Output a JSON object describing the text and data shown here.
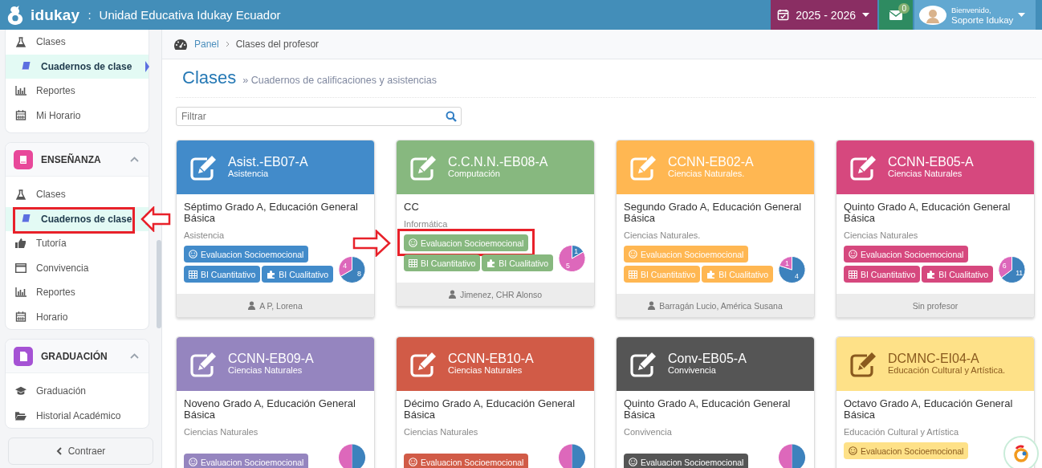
{
  "topbar": {
    "brand": "idukay",
    "separator": ":",
    "school": "Unidad Educativa Idukay Ecuador",
    "year": "2025 - 2026",
    "messages_count": "0",
    "greeting": "Bienvenido,",
    "user": "Soporte Idukay"
  },
  "sidebar": {
    "groups": [
      {
        "items": [
          {
            "kind": "flask",
            "label": "Clases",
            "selected": false,
            "highlighted": false
          },
          {
            "kind": "book",
            "label": "Cuadernos de clase",
            "selected": true,
            "highlighted": false
          },
          {
            "kind": "chart",
            "label": "Reportes",
            "selected": false,
            "highlighted": false
          },
          {
            "kind": "calendar",
            "label": "Mi Horario",
            "selected": false,
            "highlighted": false
          }
        ]
      },
      {
        "title": "ENSEÑANZA",
        "color": "#e8489a",
        "kind": "book",
        "expanded": true,
        "items": [
          {
            "kind": "flask",
            "label": "Clases",
            "selected": false,
            "highlighted": false
          },
          {
            "kind": "book",
            "label": "Cuadernos de clase",
            "selected": true,
            "highlighted": true
          },
          {
            "kind": "thumb",
            "label": "Tutoría",
            "selected": false,
            "highlighted": false
          },
          {
            "kind": "window",
            "label": "Convivencia",
            "selected": false,
            "highlighted": false
          },
          {
            "kind": "chart",
            "label": "Reportes",
            "selected": false,
            "highlighted": false
          },
          {
            "kind": "calendar",
            "label": "Horario",
            "selected": false,
            "highlighted": false
          }
        ]
      },
      {
        "title": "GRADUACIÓN",
        "color": "#a552d4",
        "kind": "doc",
        "expanded": true,
        "items": [
          {
            "kind": "cap",
            "label": "Graduación",
            "selected": false,
            "highlighted": false
          },
          {
            "kind": "folder",
            "label": "Historial Académico",
            "selected": false,
            "highlighted": false
          }
        ]
      }
    ],
    "collapse": "Contraer"
  },
  "breadcrumb": [
    {
      "label": "Panel",
      "link": true
    },
    {
      "label": "Clases del profesor",
      "link": false
    }
  ],
  "page": {
    "title": "Clases",
    "subtitle": "» Cuadernos de calificaciones y asistencias"
  },
  "filter": {
    "placeholder": "Filtrar"
  },
  "cards": [
    {
      "code": "Asist.-EB07-A",
      "subject": "Asistencia",
      "color": "#428bca",
      "grade": "Séptimo Grado A, Educación General Básica",
      "area": "Asistencia",
      "tags": [
        {
          "kind": "smile",
          "label": "Evaluacion Socioemocional",
          "highlighted": false
        },
        {
          "kind": "grid",
          "label": "BI Cuantitativo",
          "highlighted": false
        },
        {
          "kind": "puzzle",
          "label": "BI Cualitativo",
          "highlighted": false
        }
      ],
      "chart_data": {
        "type": "pie",
        "values": [
          8,
          4
        ],
        "data_labels": true
      },
      "teacher": {
        "name": "A P, Lorena",
        "icon": true
      }
    },
    {
      "code": "C.C.N.N.-EB08-A",
      "subject": "Computación",
      "color": "#87b87f",
      "grade": "CC",
      "area": "Informática",
      "tags": [
        {
          "kind": "smile",
          "label": "Evaluacion Socioemocional",
          "highlighted": true
        },
        {
          "kind": "grid",
          "label": "BI Cuantitativo",
          "highlighted": false
        },
        {
          "kind": "puzzle",
          "label": "BI Cualitativo",
          "highlighted": false
        }
      ],
      "chart_data": {
        "type": "pie",
        "values": [
          1,
          5
        ],
        "data_labels": true
      },
      "teacher": {
        "name": "Jimenez, CHR Alonso",
        "icon": true
      }
    },
    {
      "code": "CCNN-EB02-A",
      "subject": "Ciencias Naturales.",
      "color": "#ffb752",
      "grade": "Segundo Grado A, Educación General Básica",
      "area": "Ciencias Naturales.",
      "tags": [
        {
          "kind": "smile",
          "label": "Evaluacion Socioemocional",
          "highlighted": false
        },
        {
          "kind": "grid",
          "label": "BI Cuantitativo",
          "highlighted": false
        },
        {
          "kind": "puzzle",
          "label": "BI Cualitativo",
          "highlighted": false
        }
      ],
      "chart_data": {
        "type": "pie",
        "values": [
          4,
          1
        ],
        "data_labels": true
      },
      "teacher": {
        "name": "Barragán Lucio, América Susana",
        "icon": true
      }
    },
    {
      "code": "CCNN-EB05-A",
      "subject": "Ciencias Naturales",
      "color": "#d6487e",
      "grade": "Quinto Grado A, Educación General Básica",
      "area": "Ciencias Naturales",
      "tags": [
        {
          "kind": "smile",
          "label": "Evaluacion Socioemocional",
          "highlighted": false
        },
        {
          "kind": "grid",
          "label": "BI Cuantitativo",
          "highlighted": false
        },
        {
          "kind": "puzzle",
          "label": "BI Cualitativo",
          "highlighted": false
        }
      ],
      "chart_data": {
        "type": "pie",
        "values": [
          11,
          6
        ],
        "data_labels": true
      },
      "teacher": {
        "name": "Sin profesor",
        "icon": false
      }
    },
    {
      "code": "CCNN-EB09-A",
      "subject": "Ciencias Naturales",
      "color": "#9585bf",
      "grade": "Noveno Grado A, Educación General Básica",
      "area": "Ciencias Naturales",
      "tags": [
        {
          "kind": "smile",
          "label": "Evaluacion Socioemocional",
          "highlighted": false
        }
      ],
      "pie_drawing": true
    },
    {
      "code": "CCNN-EB10-A",
      "subject": "Ciencias Naturales",
      "color": "#d15b47",
      "grade": "Décimo Grado A, Educación General Básica",
      "area": "Ciencias Naturales",
      "tags": [
        {
          "kind": "smile",
          "label": "Evaluacion Socioemocional",
          "highlighted": false
        }
      ],
      "pie_drawing": true
    },
    {
      "code": "Conv-EB05-A",
      "subject": "Convivencia",
      "color": "#555555",
      "grade": "Quinto Grado A, Educación General Básica",
      "area": "Convivencia",
      "tags": [
        {
          "kind": "smile",
          "label": "Evaluacion Socioemocional",
          "highlighted": false
        }
      ],
      "pie_drawing": true
    },
    {
      "code": "DCMNC-EI04-A",
      "subject": "Educación Cultural y Artística.",
      "color": "#fee188",
      "grade": "Octavo Grado A, Educación General Básica",
      "area": "Educación Cultural y Artística",
      "tags": [
        {
          "kind": "smile",
          "label": "Evaluacion Socioemocional",
          "highlighted": false
        }
      ]
    }
  ]
}
